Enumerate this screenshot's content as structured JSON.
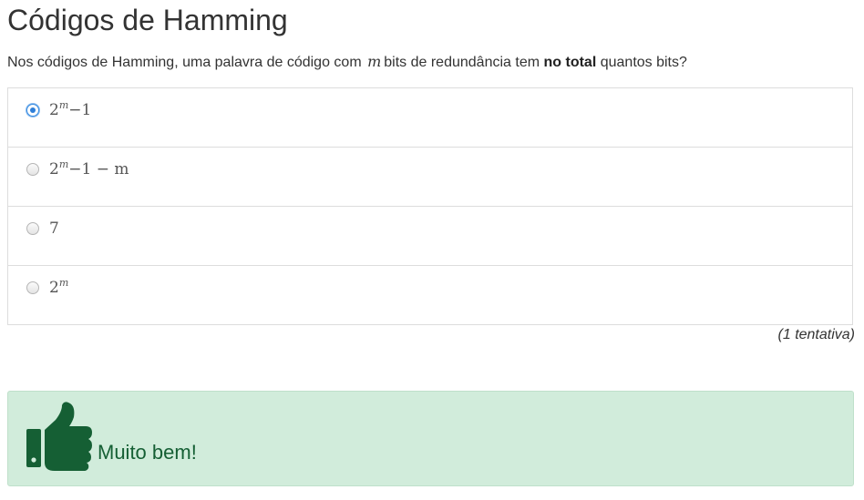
{
  "page": {
    "title": "Códigos de Hamming"
  },
  "question": {
    "text_before": "Nos códigos de Hamming, uma palavra de código com",
    "variable": "m",
    "text_middle": "bits de redundância tem",
    "text_bold": "no total",
    "text_after": "quantos bits?"
  },
  "options": [
    {
      "base": "2",
      "sup": "m",
      "rest": "−1",
      "selected": true
    },
    {
      "base": "2",
      "sup": "m",
      "rest": "−1 − m",
      "selected": false
    },
    {
      "base": "7",
      "sup": "",
      "rest": "",
      "selected": false
    },
    {
      "base": "2",
      "sup": "m",
      "rest": "",
      "selected": false
    }
  ],
  "attempts": "(1 tentativa)",
  "feedback": {
    "icon": "thumbs-up-icon",
    "text": "Muito bem!",
    "color": "#155f34",
    "background": "#d1ecdb"
  },
  "colors": {
    "radio_selected": "#2f7fd8",
    "border": "#dddddd"
  }
}
